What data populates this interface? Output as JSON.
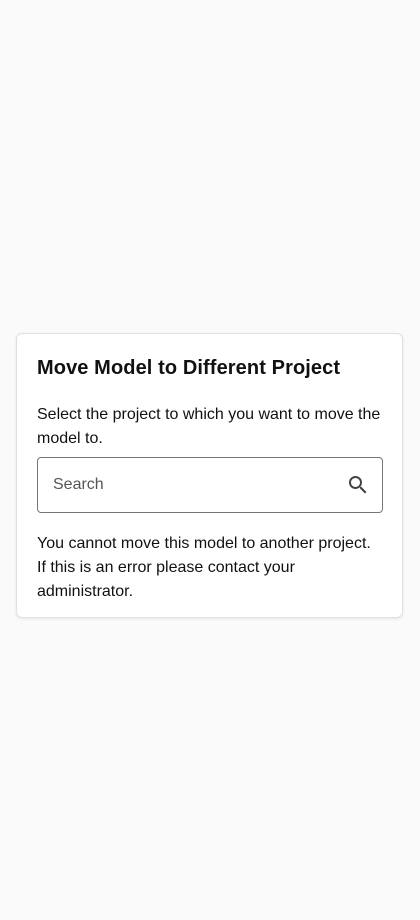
{
  "dialog": {
    "title": "Move Model to Different Project",
    "description": "Select the project to which you want to move the model to.",
    "search": {
      "placeholder": "Search",
      "value": "",
      "icon": "search-icon"
    },
    "warning": "You cannot move this model to another project. If this is an error please contact your administrator."
  },
  "colors": {
    "background": "#fafafa",
    "card": "#ffffff",
    "border": "#757575",
    "text": "#111111"
  }
}
